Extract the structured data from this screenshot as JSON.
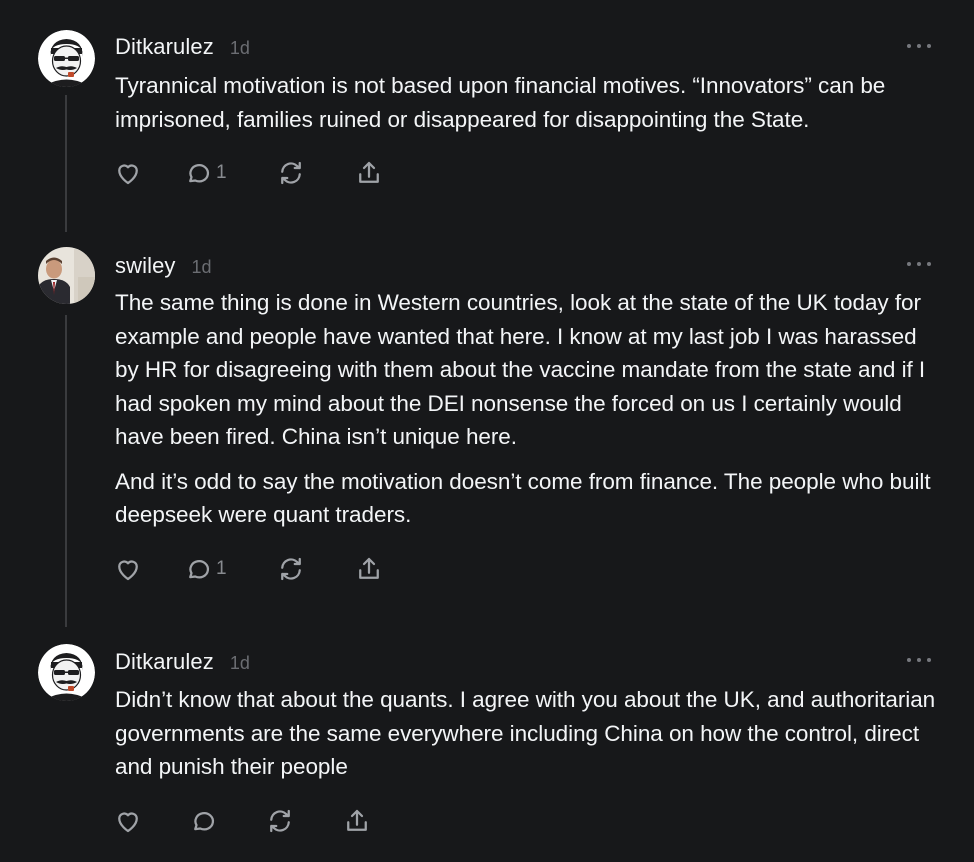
{
  "comments": [
    {
      "username": "Ditkarulez",
      "timestamp": "1d",
      "avatar_icon": "mustache-man-avatar",
      "paragraphs": [
        "Tyrannical motivation is not based upon financial motives. “Innovators” can be imprisoned, families ruined or disappeared for disappointing the State."
      ],
      "actions": {
        "reply_count": "1"
      }
    },
    {
      "username": "swiley",
      "timestamp": "1d",
      "avatar_icon": "photo-avatar",
      "paragraphs": [
        "The same thing is done in Western countries, look at the state of the UK today for example and people have wanted that here. I know at my last job I was harassed by HR for disagreeing with them about the vaccine mandate from the state and if I had spoken my mind about the DEI nonsense the forced on us I certainly would have been fired. China isn’t unique here.",
        "And it’s odd to say the motivation doesn’t come from finance. The people who built deepseek were quant traders."
      ],
      "actions": {
        "reply_count": "1"
      }
    },
    {
      "username": "Ditkarulez",
      "timestamp": "1d",
      "avatar_icon": "mustache-man-avatar",
      "paragraphs": [
        "Didn’t know that about the quants. I agree with you about the UK, and authoritarian governments are the same everywhere including China on how the control, direct and punish their people"
      ],
      "actions": {
        "reply_count": ""
      }
    }
  ],
  "icons": [
    "heart-icon",
    "comment-icon",
    "restack-icon",
    "share-icon",
    "more-icon"
  ],
  "colors": {
    "background": "#17181a",
    "text": "#f3f5f7",
    "muted": "#6b6d72",
    "icon": "#a0a3a8"
  }
}
